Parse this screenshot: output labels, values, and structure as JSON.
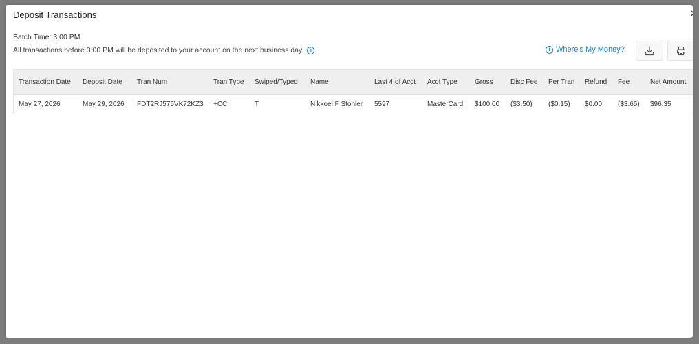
{
  "modal": {
    "title": "Deposit Transactions",
    "close_label": "✕",
    "batch_time": "Batch Time: 3:00 PM",
    "note": "All transactions before 3:00 PM will be deposited to your account on the next business day.",
    "wheres_my_money": "Where's My Money?",
    "accent_color": "#1b7fc4"
  },
  "table": {
    "headers": [
      "Transaction Date",
      "Deposit Date",
      "Tran Num",
      "Tran Type",
      "Swiped/Typed",
      "Name",
      "Last 4 of Acct",
      "Acct Type",
      "Gross",
      "Disc Fee",
      "Per Tran",
      "Refund",
      "Fee",
      "Net Amount"
    ],
    "rows": [
      [
        "May 27, 2026",
        "May 29, 2026",
        "FDT2RJ575VK72KZ3",
        "+CC",
        "T",
        "Nikkoel F Stohler",
        "5597",
        "MasterCard",
        "$100.00",
        "($3.50)",
        "($0.15)",
        "$0.00",
        "($3.65)",
        "$96.35"
      ]
    ]
  },
  "icons": {
    "download": "download-icon",
    "print": "printer-icon",
    "info": "info-icon",
    "close": "close-icon"
  }
}
